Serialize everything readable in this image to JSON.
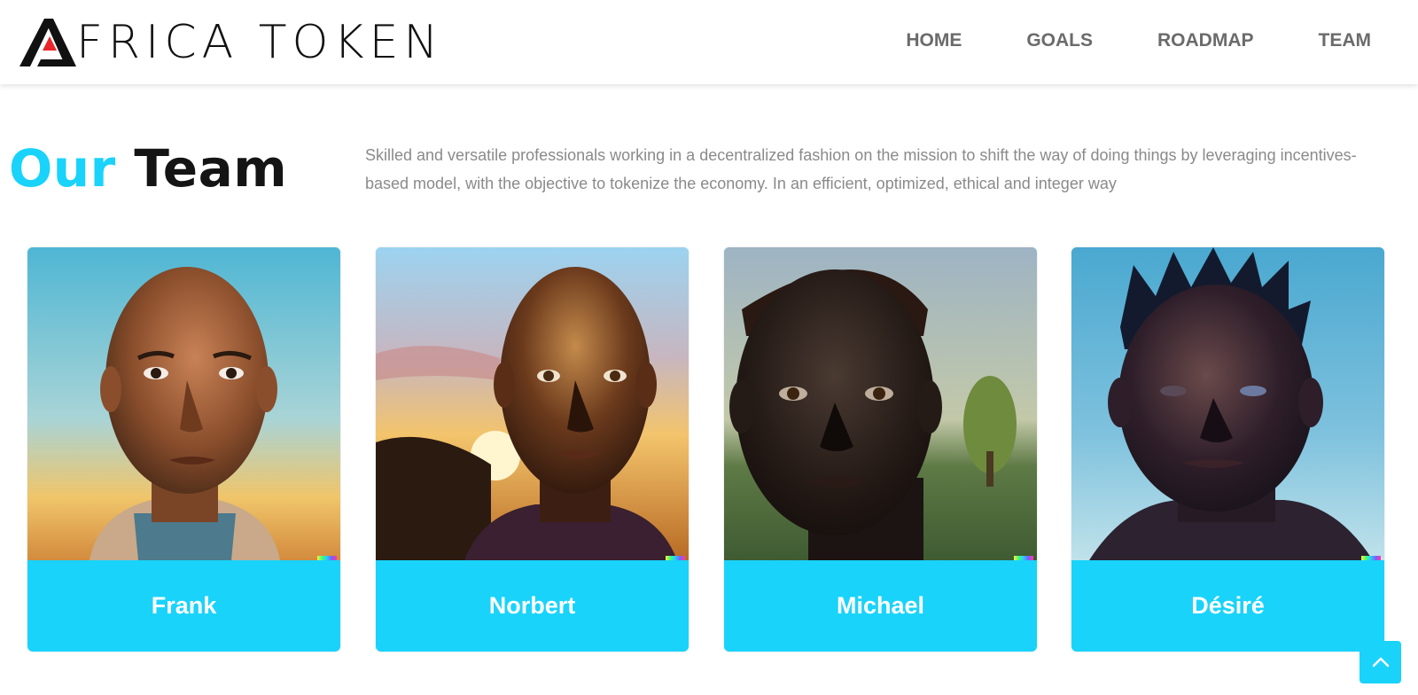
{
  "brand": {
    "logo_text": "FRICA TOKEN",
    "accent_color": "#19d3fb",
    "logo_red": "#e8262b"
  },
  "nav": {
    "items": [
      "HOME",
      "GOALS",
      "ROADMAP",
      "TEAM"
    ]
  },
  "section": {
    "title_accent": "Our",
    "title_main": "Team",
    "description": "Skilled and versatile professionals working in a decentralized fashion on the mission to shift the way of doing things by leveraging incentives-based model, with the objective to tokenize the economy. In an efficient, optimized, ethical and integer way"
  },
  "team": [
    {
      "name": "Frank"
    },
    {
      "name": "Norbert"
    },
    {
      "name": "Michael"
    },
    {
      "name": "Désiré"
    }
  ],
  "scroll_top": {
    "icon": "chevron-up-icon"
  }
}
